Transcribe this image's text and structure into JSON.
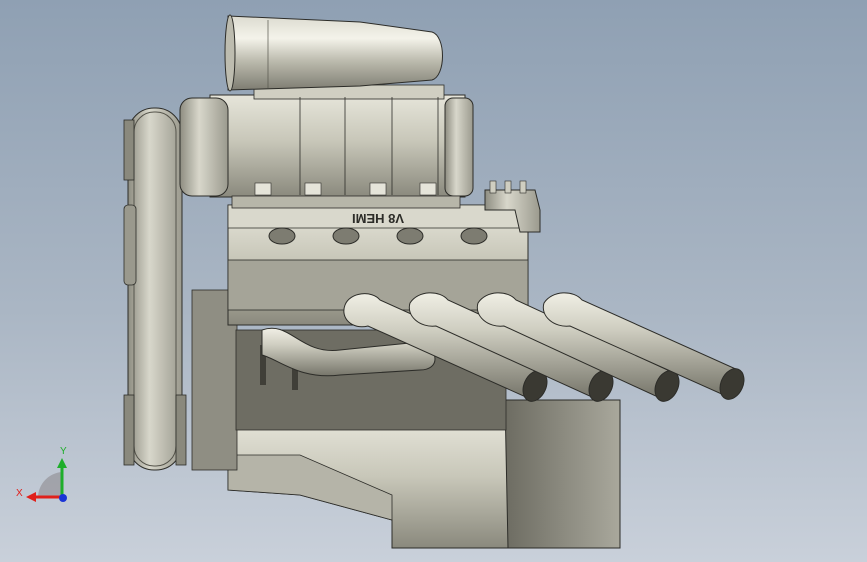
{
  "viewport": {
    "background_top": "#8fa0b3",
    "background_bottom": "#c9d0da"
  },
  "model": {
    "valve_cover_text": "V8 HEMI",
    "base_color": "#c9c8bb",
    "shadow_color": "#7d7c71",
    "highlight_color": "#e8e7dc",
    "edge_color": "#2c2c28"
  },
  "triad": {
    "x_label": "X",
    "y_label": "Y",
    "x_color": "#e0201b",
    "y_color": "#1fae2b",
    "z_color": "#1a34d6"
  }
}
